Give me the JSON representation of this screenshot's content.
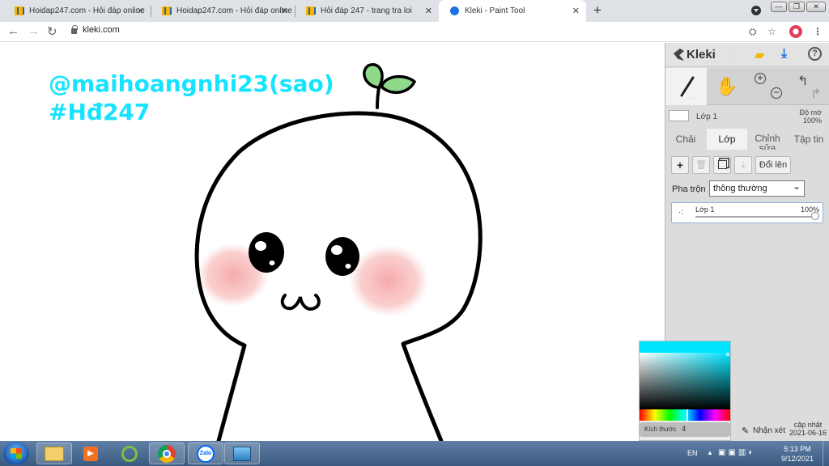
{
  "browser": {
    "tabs": [
      {
        "title": "Hoidap247.com - Hỏi đáp online",
        "active": false
      },
      {
        "title": "Hoidap247.com - Hỏi đáp online",
        "active": false
      },
      {
        "title": "Hỏi đáp 247 - trang tra loi",
        "active": false
      },
      {
        "title": "Kleki - Paint Tool",
        "active": true
      }
    ],
    "new_tab": "+",
    "close_glyph": "✕",
    "url": "kleki.com"
  },
  "canvas": {
    "signature_line1": "@maihoangnhi23(sao)",
    "signature_line2": "#Hđ247"
  },
  "kleki": {
    "logo": "Kleki",
    "layer_name": "Lớp 1",
    "opacity_label": "Độ mờ",
    "opacity_value": "100%",
    "tabs": [
      "Chải",
      "Lớp",
      "Chỉnh sửa",
      "Tập tin"
    ],
    "active_tab": "Lớp",
    "buttons": {
      "add": "+",
      "merge_label": "Đổi lên"
    },
    "blend_label": "Pha trộn",
    "blend_value": "thông thường",
    "layer_item": {
      "name": "Lớp 1",
      "opacity": "100%",
      "opacity_fraction": 1.0
    },
    "feedback": "Nhận xét",
    "update_line1": "cập nhật",
    "update_line2": "2021-06-16"
  },
  "colorpicker": {
    "color": "#00e5ff",
    "size_label": "Kích thước",
    "size_value": "4"
  },
  "taskbar": {
    "lang": "EN",
    "time": "5:13 PM",
    "date": "9/12/2021"
  }
}
